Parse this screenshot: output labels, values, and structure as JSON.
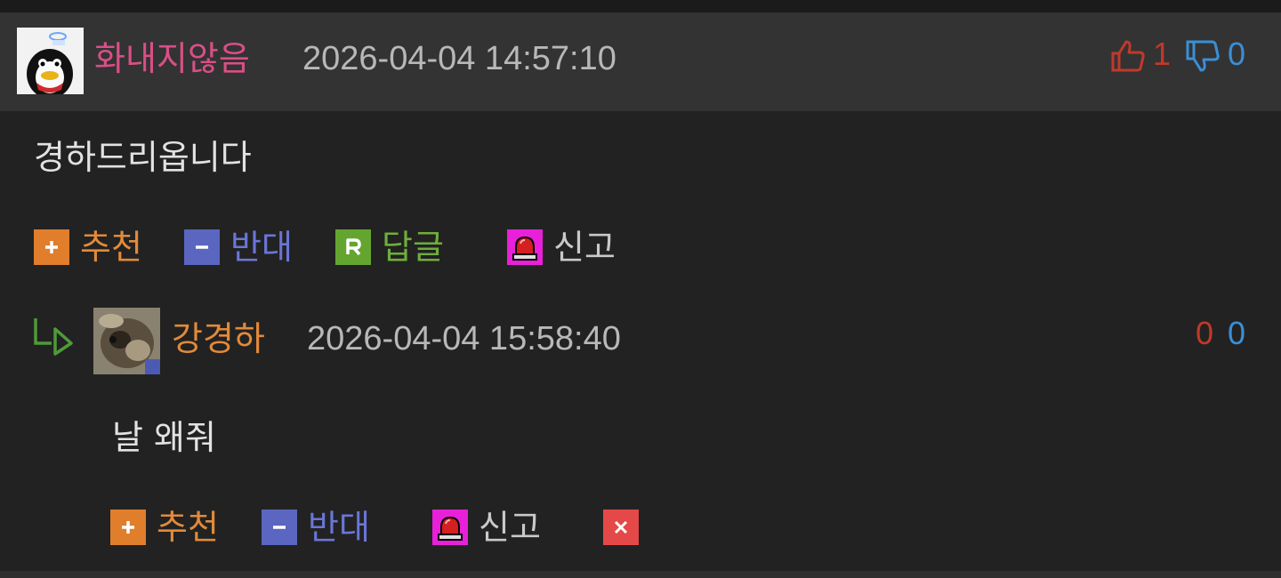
{
  "comment": {
    "author": "화내지않음",
    "datetime": "2026-04-04 14:57:10",
    "likes": "1",
    "dislikes": "0",
    "text": "경하드리옵니다",
    "actions": {
      "recommend": "추천",
      "oppose": "반대",
      "reply": "답글",
      "report": "신고"
    }
  },
  "reply": {
    "author": "강경하",
    "datetime": "2026-04-04 15:58:40",
    "likes": "0",
    "dislikes": "0",
    "text": "날 왜줘",
    "actions": {
      "recommend": "추천",
      "oppose": "반대",
      "report": "신고"
    }
  },
  "colors": {
    "author_primary": "#d94f86",
    "author_reply": "#e28a3a",
    "like": "#c0392b",
    "dislike": "#3a8fd6",
    "recommend": "#e28a3a",
    "oppose": "#6a76d8",
    "reply": "#6fae3a",
    "report": "#c9c9c9"
  },
  "icons": [
    "thumbs-up-icon",
    "thumbs-down-icon",
    "plus-icon",
    "minus-icon",
    "reply-r-icon",
    "siren-icon",
    "reply-arrow-icon",
    "delete-x-icon"
  ]
}
